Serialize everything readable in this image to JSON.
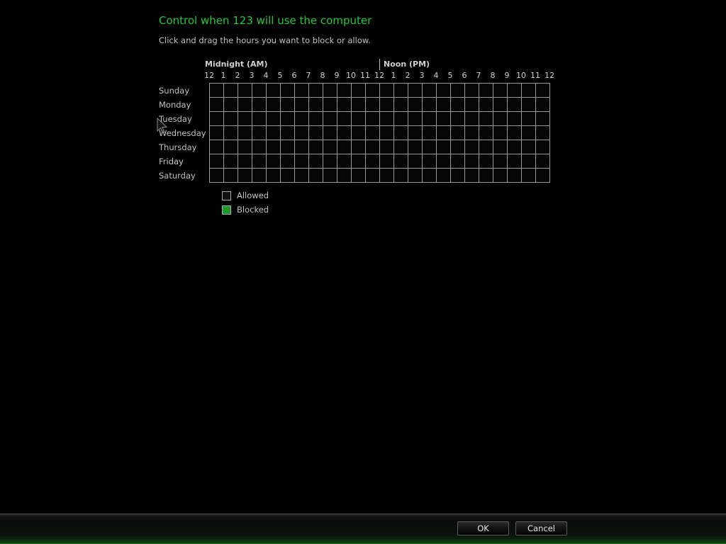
{
  "header": {
    "title": "Control when 123 will use the computer",
    "instructions": "Click and drag the hours you want to block or allow."
  },
  "schedule": {
    "am_label": "Midnight (AM)",
    "pm_label": "Noon (PM)",
    "hours": [
      "12",
      "1",
      "2",
      "3",
      "4",
      "5",
      "6",
      "7",
      "8",
      "9",
      "10",
      "11",
      "12",
      "1",
      "2",
      "3",
      "4",
      "5",
      "6",
      "7",
      "8",
      "9",
      "10",
      "11",
      "12"
    ],
    "days": [
      "Sunday",
      "Monday",
      "Tuesday",
      "Wednesday",
      "Thursday",
      "Friday",
      "Saturday"
    ],
    "blocked_cells": []
  },
  "legend": {
    "allowed_label": "Allowed",
    "blocked_label": "Blocked",
    "blocked_color": "#1f9a2a"
  },
  "actions": {
    "ok_label": "OK",
    "cancel_label": "Cancel"
  },
  "theme": {
    "accent": "#22c93a",
    "background": "#000000"
  },
  "icons": {
    "pointer": "mouse-pointer-icon"
  }
}
